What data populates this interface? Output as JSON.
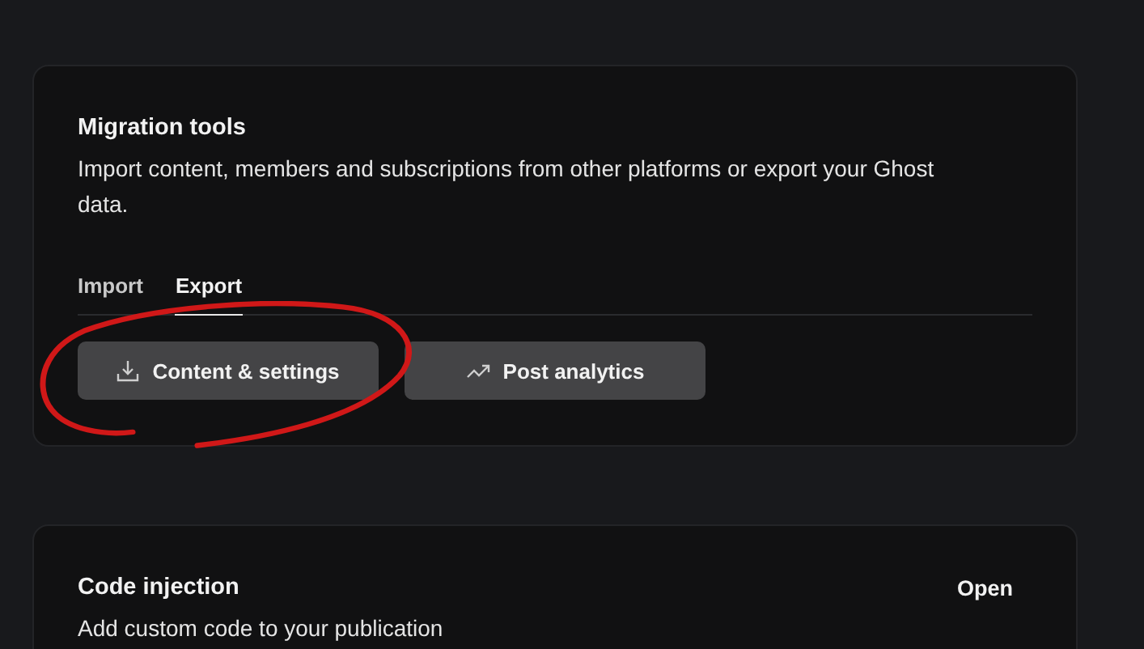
{
  "migration": {
    "title": "Migration tools",
    "description": "Import content, members and subscriptions from other platforms or export your Ghost data.",
    "tabs": [
      {
        "label": "Import",
        "selected": false
      },
      {
        "label": "Export",
        "selected": true
      }
    ],
    "buttons": [
      {
        "label": "Content & settings",
        "kind": "download"
      },
      {
        "label": "Post analytics",
        "kind": "trend"
      }
    ]
  },
  "code_injection": {
    "title": "Code injection",
    "description": "Add custom code to your publication",
    "action": "Open"
  }
}
